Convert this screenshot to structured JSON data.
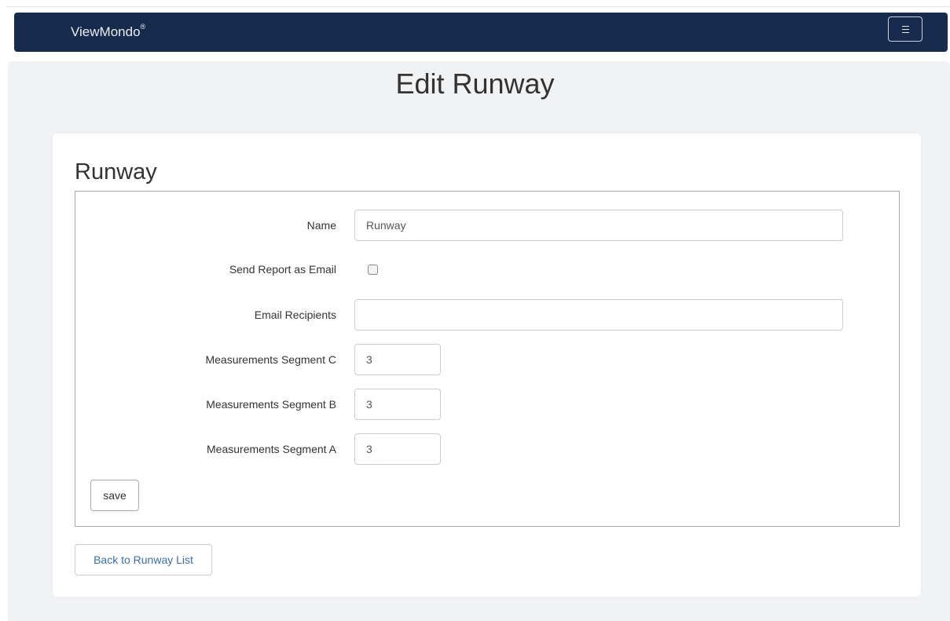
{
  "navbar": {
    "brand": "ViewMondo",
    "brand_mark": "®",
    "menu_icon": "hamburger-menu-icon"
  },
  "page": {
    "title": "Edit Runway"
  },
  "card": {
    "title": "Runway"
  },
  "form": {
    "name": {
      "label": "Name",
      "value": "Runway"
    },
    "send_report": {
      "label": "Send Report as Email",
      "checked": false
    },
    "email_recipients": {
      "label": "Email Recipients",
      "value": ""
    },
    "segment_c": {
      "label": "Measurements Segment C",
      "value": "3"
    },
    "segment_b": {
      "label": "Measurements Segment B",
      "value": "3"
    },
    "segment_a": {
      "label": "Measurements Segment A",
      "value": "3"
    },
    "save_label": "save"
  },
  "back_link": "Back to Runway List",
  "colors": {
    "navbar": "#172b4d",
    "page_background": "#f1f2f4",
    "link": "#3d6fa6"
  }
}
